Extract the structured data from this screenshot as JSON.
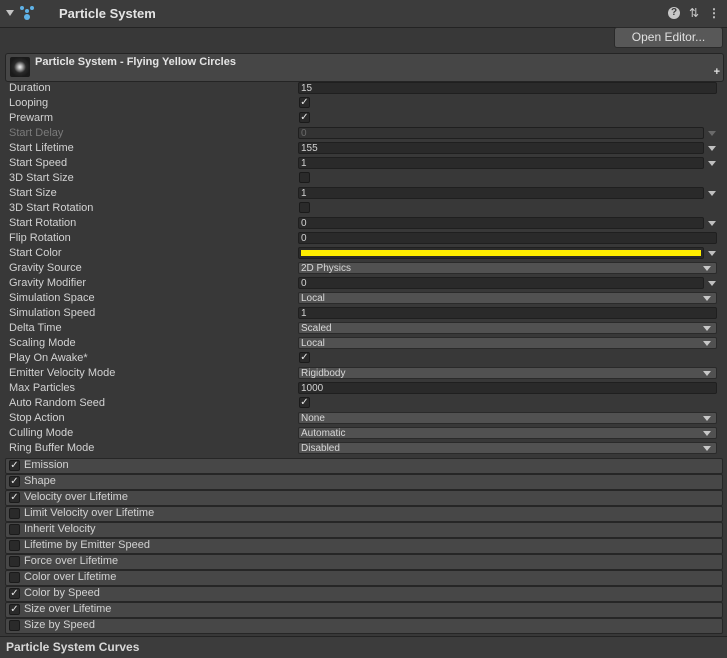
{
  "component": {
    "title": "Particle System",
    "icons": [
      "fold-arrow-icon",
      "particle-system-icon",
      "help-icon",
      "presets-icon",
      "kebab-menu-icon"
    ]
  },
  "toolbar": {
    "open_editor_label": "Open Editor..."
  },
  "main_module": {
    "title": "Particle System - Flying Yellow Circles",
    "plus": "+"
  },
  "properties": {
    "duration": {
      "label": "Duration",
      "value": "15"
    },
    "looping": {
      "label": "Looping",
      "checked": true,
      "mark": "✓"
    },
    "prewarm": {
      "label": "Prewarm",
      "checked": true,
      "mark": "✓"
    },
    "start_delay": {
      "label": "Start Delay",
      "value": "0",
      "disabled": true
    },
    "start_lifetime": {
      "label": "Start Lifetime",
      "value": "155"
    },
    "start_speed": {
      "label": "Start Speed",
      "value": "1"
    },
    "start_size_3d": {
      "label": "3D Start Size",
      "checked": false,
      "mark": ""
    },
    "start_size": {
      "label": "Start Size",
      "value": "1"
    },
    "start_rotation_3d": {
      "label": "3D Start Rotation",
      "checked": false,
      "mark": ""
    },
    "start_rotation": {
      "label": "Start Rotation",
      "value": "0"
    },
    "flip_rotation": {
      "label": "Flip Rotation",
      "value": "0"
    },
    "start_color": {
      "label": "Start Color",
      "color": "#ffee00"
    },
    "gravity_source": {
      "label": "Gravity Source",
      "value": "2D Physics"
    },
    "gravity_modifier": {
      "label": "Gravity Modifier",
      "value": "0"
    },
    "simulation_space": {
      "label": "Simulation Space",
      "value": "Local"
    },
    "simulation_speed": {
      "label": "Simulation Speed",
      "value": "1"
    },
    "delta_time": {
      "label": "Delta Time",
      "value": "Scaled"
    },
    "scaling_mode": {
      "label": "Scaling Mode",
      "value": "Local"
    },
    "play_on_awake": {
      "label": "Play On Awake*",
      "checked": true,
      "mark": "✓"
    },
    "emitter_velocity_mode": {
      "label": "Emitter Velocity Mode",
      "value": "Rigidbody"
    },
    "max_particles": {
      "label": "Max Particles",
      "value": "1000"
    },
    "auto_random_seed": {
      "label": "Auto Random Seed",
      "checked": true,
      "mark": "✓"
    },
    "stop_action": {
      "label": "Stop Action",
      "value": "None"
    },
    "culling_mode": {
      "label": "Culling Mode",
      "value": "Automatic"
    },
    "ring_buffer_mode": {
      "label": "Ring Buffer Mode",
      "value": "Disabled"
    }
  },
  "modules": [
    {
      "label": "Emission",
      "checked": true,
      "mark": "✓"
    },
    {
      "label": "Shape",
      "checked": true,
      "mark": "✓"
    },
    {
      "label": "Velocity over Lifetime",
      "checked": true,
      "mark": "✓"
    },
    {
      "label": "Limit Velocity over Lifetime",
      "checked": false,
      "mark": ""
    },
    {
      "label": "Inherit Velocity",
      "checked": false,
      "mark": ""
    },
    {
      "label": "Lifetime by Emitter Speed",
      "checked": false,
      "mark": ""
    },
    {
      "label": "Force over Lifetime",
      "checked": false,
      "mark": ""
    },
    {
      "label": "Color over Lifetime",
      "checked": false,
      "mark": ""
    },
    {
      "label": "Color by Speed",
      "checked": true,
      "mark": "✓"
    },
    {
      "label": "Size over Lifetime",
      "checked": true,
      "mark": "✓"
    },
    {
      "label": "Size by Speed",
      "checked": false,
      "mark": ""
    }
  ],
  "curves": {
    "title": "Particle System Curves"
  }
}
